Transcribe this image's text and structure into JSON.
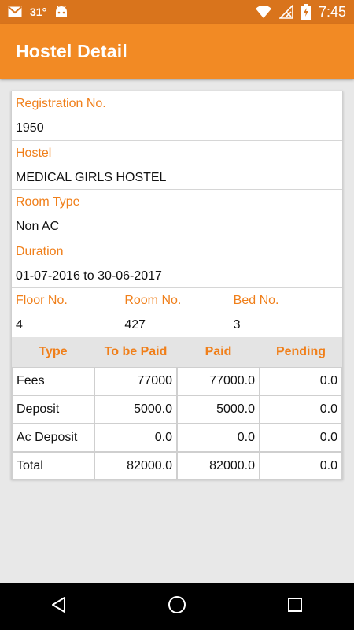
{
  "status_bar": {
    "temperature": "31°",
    "time": "7:45",
    "battery": "7",
    "icons": [
      "gmail-icon",
      "android-icon",
      "wifi-icon",
      "no-signal-icon",
      "battery-icon"
    ]
  },
  "app_bar": {
    "title": "Hostel Detail"
  },
  "details": {
    "registration_label": "Registration No.",
    "registration_value": "1950",
    "hostel_label": "Hostel",
    "hostel_value": "MEDICAL GIRLS HOSTEL",
    "room_type_label": "Room Type",
    "room_type_value": "Non AC",
    "duration_label": "Duration",
    "duration_value": "01-07-2016 to 30-06-2017",
    "floor_label": "Floor No.",
    "floor_value": "4",
    "room_label": "Room No.",
    "room_value": "427",
    "bed_label": "Bed No.",
    "bed_value": "3"
  },
  "payments": {
    "headers": [
      "Type",
      "To be Paid",
      "Paid",
      "Pending"
    ],
    "rows": [
      [
        "Fees",
        "77000",
        "77000.0",
        "0.0"
      ],
      [
        "Deposit",
        "5000.0",
        "5000.0",
        "0.0"
      ],
      [
        "Ac Deposit",
        "0.0",
        "0.0",
        "0.0"
      ],
      [
        "Total",
        "82000.0",
        "82000.0",
        "0.0"
      ]
    ]
  },
  "nav_bar": {
    "icons": [
      "back-icon",
      "home-icon",
      "recents-icon"
    ]
  },
  "colors": {
    "status_bar": "#d9741c",
    "app_bar": "#f28a24",
    "accent_label": "#f07f1a"
  }
}
